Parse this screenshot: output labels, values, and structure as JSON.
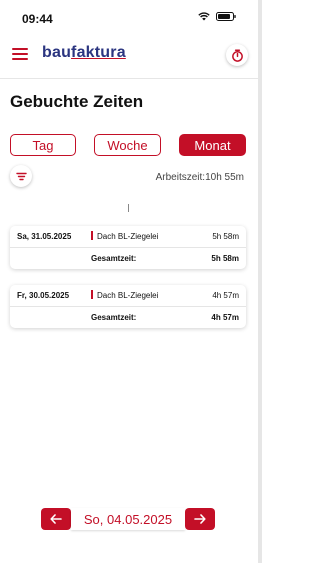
{
  "status_bar": {
    "time": "09:44"
  },
  "header": {
    "logo_text_1": "bau",
    "logo_text_2": "faktura"
  },
  "page": {
    "title": "Gebuchte Zeiten"
  },
  "tabs": [
    {
      "label": "Tag",
      "active": false
    },
    {
      "label": "Woche",
      "active": false
    },
    {
      "label": "Monat",
      "active": true
    }
  ],
  "summary": {
    "arbeitszeit": "Arbeitszeit:10h 55m"
  },
  "entries": [
    {
      "date": "Sa, 31.05.2025",
      "project": "Dach BL-Ziegelei",
      "duration": "5h 58m",
      "total_label": "Gesamtzeit:",
      "total": "5h 58m"
    },
    {
      "date": "Fr, 30.05.2025",
      "project": "Dach BL-Ziegelei",
      "duration": "4h 57m",
      "total_label": "Gesamtzeit:",
      "total": "4h 57m"
    }
  ],
  "date_nav": {
    "current": "So, 04.05.2025"
  },
  "colors": {
    "accent": "#c30f27",
    "brand_blue": "#2b3580"
  },
  "icons": {
    "menu": "hamburger-icon",
    "timer": "stopwatch-icon",
    "filter": "filter-icon",
    "prev": "arrow-left-icon",
    "next": "arrow-right-icon"
  }
}
